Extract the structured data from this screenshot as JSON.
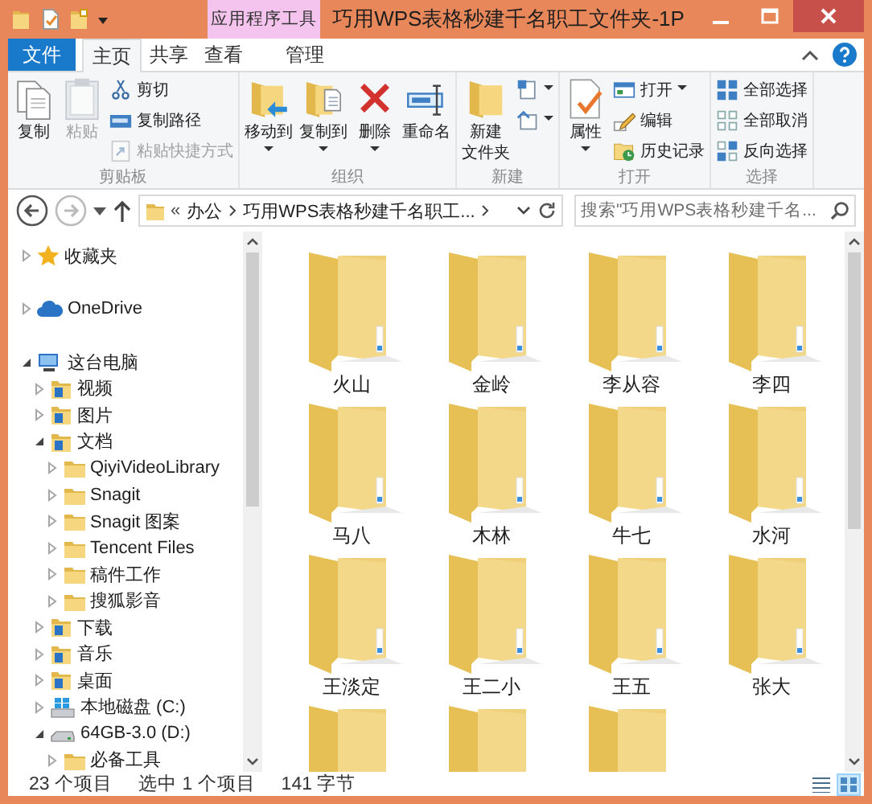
{
  "window": {
    "title": "巧用WPS表格秒建千名职工文件夹-1P",
    "context_tab_group": "应用程序工具"
  },
  "tabs": [
    {
      "label": "文件",
      "kind": "file",
      "selected": false
    },
    {
      "label": "主页",
      "kind": "normal",
      "selected": true
    },
    {
      "label": "共享",
      "kind": "normal",
      "selected": false
    },
    {
      "label": "查看",
      "kind": "normal",
      "selected": false
    },
    {
      "label": "管理",
      "kind": "context",
      "selected": false
    }
  ],
  "ribbon": {
    "groups": [
      {
        "label": "剪贴板",
        "items": [
          {
            "kind": "large",
            "label": "复制",
            "disabled": false,
            "dropdown": false
          },
          {
            "kind": "large",
            "label": "粘贴",
            "disabled": true,
            "dropdown": false
          },
          {
            "kind": "stack",
            "buttons": [
              {
                "label": "剪切",
                "disabled": false,
                "dropdown": false
              },
              {
                "label": "复制路径",
                "disabled": false,
                "dropdown": false
              },
              {
                "label": "粘贴快捷方式",
                "disabled": true,
                "dropdown": false
              }
            ]
          }
        ]
      },
      {
        "label": "组织",
        "items": [
          {
            "kind": "large",
            "label": "移动到",
            "disabled": false,
            "dropdown": true
          },
          {
            "kind": "large",
            "label": "复制到",
            "disabled": false,
            "dropdown": true
          },
          {
            "kind": "large",
            "label": "删除",
            "disabled": false,
            "dropdown": true
          },
          {
            "kind": "large",
            "label": "重命名",
            "disabled": false,
            "dropdown": false
          }
        ]
      },
      {
        "label": "新建",
        "items": [
          {
            "kind": "large",
            "label_lines": [
              "新建",
              "文件夹"
            ],
            "disabled": false,
            "dropdown": false
          },
          {
            "kind": "stack",
            "buttons": [
              {
                "disabled": false,
                "dropdown": true
              },
              {
                "disabled": false,
                "dropdown": true
              }
            ]
          }
        ]
      },
      {
        "label": "打开",
        "items": [
          {
            "kind": "large",
            "label": "属性",
            "disabled": false,
            "dropdown": true
          },
          {
            "kind": "stack",
            "buttons": [
              {
                "label": "打开",
                "disabled": false,
                "dropdown": true
              },
              {
                "label": "编辑",
                "disabled": false,
                "dropdown": false
              },
              {
                "label": "历史记录",
                "disabled": false,
                "dropdown": false
              }
            ]
          }
        ]
      },
      {
        "label": "选择",
        "items": [
          {
            "kind": "stack",
            "buttons": [
              {
                "label": "全部选择",
                "disabled": false,
                "dropdown": false
              },
              {
                "label": "全部取消",
                "disabled": false,
                "dropdown": false
              },
              {
                "label": "反向选择",
                "disabled": false,
                "dropdown": false
              }
            ]
          }
        ]
      }
    ]
  },
  "address_bar": {
    "overflow": "«",
    "path": [
      "办公",
      "巧用WPS表格秒建千名职工..."
    ],
    "back_disabled": false,
    "forward_disabled": true
  },
  "search": {
    "placeholder": "搜索\"巧用WPS表格秒建千名..."
  },
  "nav_tree": [
    {
      "label": "收藏夹",
      "kind": "favorites",
      "expanded": false
    },
    {
      "label": "OneDrive",
      "kind": "cloud",
      "expanded": false
    },
    {
      "label": "这台电脑",
      "kind": "computer",
      "expanded": true,
      "children": [
        {
          "label": "视频",
          "kind": "library",
          "expanded": false
        },
        {
          "label": "图片",
          "kind": "library",
          "expanded": false
        },
        {
          "label": "文档",
          "kind": "library",
          "expanded": true,
          "children": [
            {
              "label": "QiyiVideoLibrary",
              "kind": "folder",
              "expanded": false
            },
            {
              "label": "Snagit",
              "kind": "folder",
              "expanded": false
            },
            {
              "label": "Snagit 图案",
              "kind": "folder",
              "expanded": false
            },
            {
              "label": "Tencent Files",
              "kind": "folder",
              "expanded": false
            },
            {
              "label": "稿件工作",
              "kind": "folder",
              "expanded": false
            },
            {
              "label": "搜狐影音",
              "kind": "folder",
              "expanded": false
            }
          ]
        },
        {
          "label": "下载",
          "kind": "library",
          "expanded": false
        },
        {
          "label": "音乐",
          "kind": "library",
          "expanded": false
        },
        {
          "label": "桌面",
          "kind": "library",
          "expanded": false
        },
        {
          "label": "本地磁盘 (C:)",
          "kind": "system_drive",
          "expanded": false
        },
        {
          "label": "64GB-3.0 (D:)",
          "kind": "drive",
          "expanded": true,
          "children": [
            {
              "label": "必备工具",
              "kind": "folder",
              "expanded": false
            }
          ]
        }
      ]
    }
  ],
  "files": [
    {
      "label": "火山",
      "kind": "folder"
    },
    {
      "label": "金岭",
      "kind": "folder"
    },
    {
      "label": "李从容",
      "kind": "folder"
    },
    {
      "label": "李四",
      "kind": "folder"
    },
    {
      "label": "马八",
      "kind": "folder"
    },
    {
      "label": "木林",
      "kind": "folder"
    },
    {
      "label": "牛七",
      "kind": "folder"
    },
    {
      "label": "水河",
      "kind": "folder"
    },
    {
      "label": "王淡定",
      "kind": "folder"
    },
    {
      "label": "王二小",
      "kind": "folder"
    },
    {
      "label": "王五",
      "kind": "folder"
    },
    {
      "label": "张大",
      "kind": "folder"
    },
    {
      "kind": "folder"
    },
    {
      "kind": "folder"
    },
    {
      "kind": "folder"
    }
  ],
  "status_bar": {
    "item_count": "23 个项目",
    "selection": "选中 1 个项目",
    "size": "141 字节",
    "views": [
      {
        "kind": "details",
        "selected": false
      },
      {
        "kind": "large_icons",
        "selected": true
      }
    ]
  }
}
